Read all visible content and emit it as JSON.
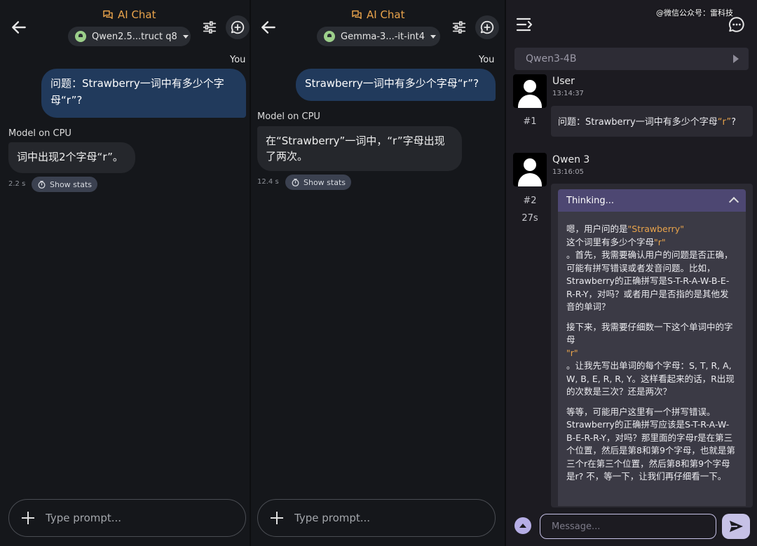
{
  "left_panel": {
    "title": "AI Chat",
    "model": "Qwen2.5...truct q8",
    "you_label": "You",
    "user_message": "问题：Strawberry一词中有多少个字母“r”?",
    "model_label": "Model on CPU",
    "bot_message": "词中出现2个字母“r”。",
    "time": "2.2 s",
    "stats_label": "Show stats",
    "prompt_placeholder": "Type prompt..."
  },
  "mid_panel": {
    "title": "AI Chat",
    "model": "Gemma-3...-it-int4",
    "you_label": "You",
    "user_message": "Strawberry一词中有多少个字母“r”?",
    "model_label": "Model on CPU",
    "bot_message": "在“Strawberry”一词中，“r”字母出现了两次。",
    "time": "12.4 s",
    "stats_label": "Show stats",
    "prompt_placeholder": "Type prompt..."
  },
  "right_panel": {
    "watermark": "@微信公众号：雷科技",
    "model": "Qwen3-4B",
    "messages": [
      {
        "name": "User",
        "time": "13:14:37",
        "index": "#1",
        "text_pre": "问题：Strawberry一词中有多少个字母",
        "text_hl": "“r”",
        "text_post": "?"
      },
      {
        "name": "Qwen 3",
        "time": "13:16:05",
        "index": "#2",
        "duration": "27s",
        "thinking_label": "Thinking...",
        "t1a": "嗯，用户问的是",
        "t1b": "\"Strawberry\"",
        "t1c": "这个词里有多少个字母",
        "t1d": "\"r\"",
        "t1e": "。首先，我需要确认用户的问题是否正确，可能有拼写错误或者发音问题。比如，Strawberry的正确拼写是S-T-R-A-W-B-E-R-R-Y，对吗？或者用户是否指的是其他发音的单词？",
        "t2a": "接下来，我需要仔细数一下这个单词中的字母",
        "t2b": "\"r\"",
        "t2c": "。让我先写出单词的每个字母：S, T, R, A, W, B, E, R, R, Y。这样看起来的话，R出现的次数是三次？还是两次？",
        "t3": "等等，可能用户这里有一个拼写错误。Strawberry的正确拼写应该是S-T-R-A-W-B-E-R-R-Y，对吗？那里面的字母r是在第三个位置，然后是第8和第9个字母，也就是第三个r在第三个位置，然后第8和第9个字母是r? 不，等一下，让我们再仔细看一下。"
      }
    ],
    "message_placeholder": "Message..."
  },
  "colors": {
    "accent": "#e8a34b",
    "user_bubble": "#213a5c",
    "bot_bubble": "#25272c",
    "thinking_header": "#4d4772",
    "send_button": "#c6c1e6"
  },
  "icons": [
    "back-arrow-icon",
    "chat-icon",
    "robot-icon",
    "caret-down-icon",
    "sliders-icon",
    "new-chat-icon",
    "timer-icon",
    "plus-icon",
    "menu-icon",
    "message-bubble-icon",
    "play-icon",
    "chevron-up-icon",
    "up-arrow-icon",
    "send-icon",
    "person-icon"
  ]
}
